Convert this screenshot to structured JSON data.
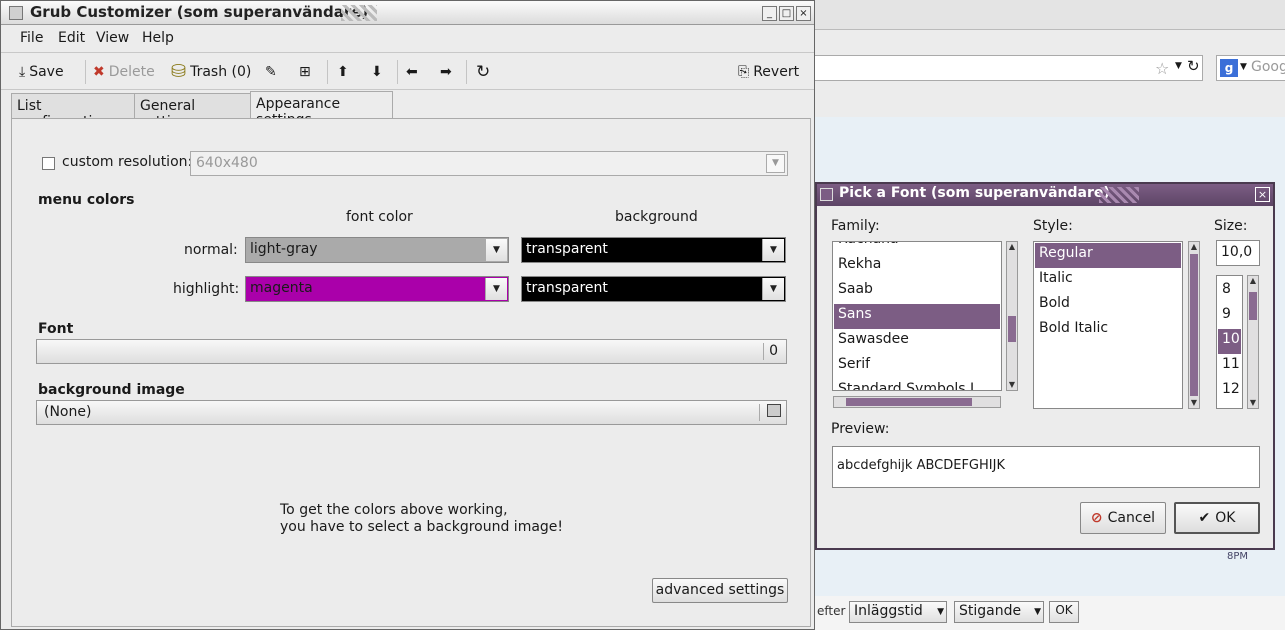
{
  "main_window": {
    "title": "Grub Customizer (som superanvändare)",
    "menu": [
      "File",
      "Edit",
      "View",
      "Help"
    ],
    "toolbar": {
      "save": "Save",
      "delete": "Delete",
      "trash": "Trash (0)",
      "revert": "Revert"
    },
    "tabs": [
      "List configuration",
      "General settings",
      "Appearance settings"
    ],
    "active_tab": "Appearance settings",
    "appearance": {
      "custom_resolution_label": "custom resolution:",
      "custom_resolution_checked": false,
      "custom_resolution_value": "640x480",
      "menu_colors_heading": "menu colors",
      "font_color_heading": "font color",
      "background_heading": "background",
      "normal_label": "normal:",
      "normal_font_color": "light-gray",
      "normal_background": "transparent",
      "highlight_label": "highlight:",
      "highlight_font_color": "magenta",
      "highlight_background": "transparent",
      "font_heading": "Font",
      "font_size": "0",
      "background_image_heading": "background image",
      "background_image_value": "(None)",
      "note_line1": "To get the colors above working,",
      "note_line2": "you have to select a background image!",
      "advanced_button": "advanced settings"
    },
    "colors": {
      "light_gray": "#aaaaaa",
      "magenta": "#aa00aa",
      "black": "#000000"
    }
  },
  "font_dialog": {
    "title": "Pick a Font (som superanvändare)",
    "family_label": "Family:",
    "style_label": "Style:",
    "size_label": "Size:",
    "families": [
      "Rachana",
      "Rekha",
      "Saab",
      "Sans",
      "Sawasdee",
      "Serif",
      "Standard Symbols L"
    ],
    "selected_family": "Sans",
    "styles": [
      "Regular",
      "Italic",
      "Bold",
      "Bold Italic"
    ],
    "selected_style": "Regular",
    "size_value": "10,0",
    "sizes": [
      "8",
      "9",
      "10",
      "11",
      "12"
    ],
    "selected_size": "10",
    "preview_label": "Preview:",
    "preview_text": "abcdefghijk ABCDEFGHIJK",
    "cancel": "Cancel",
    "ok": "OK",
    "accent": "#7c5d84"
  },
  "background_browser": {
    "search_placeholder": "Goog",
    "search_engine_icon": "g",
    "bottom_text": "efter",
    "sort_field": "Inläggstid",
    "sort_order": "Stigande",
    "ok": "OK",
    "avatar_text": "8PM"
  }
}
